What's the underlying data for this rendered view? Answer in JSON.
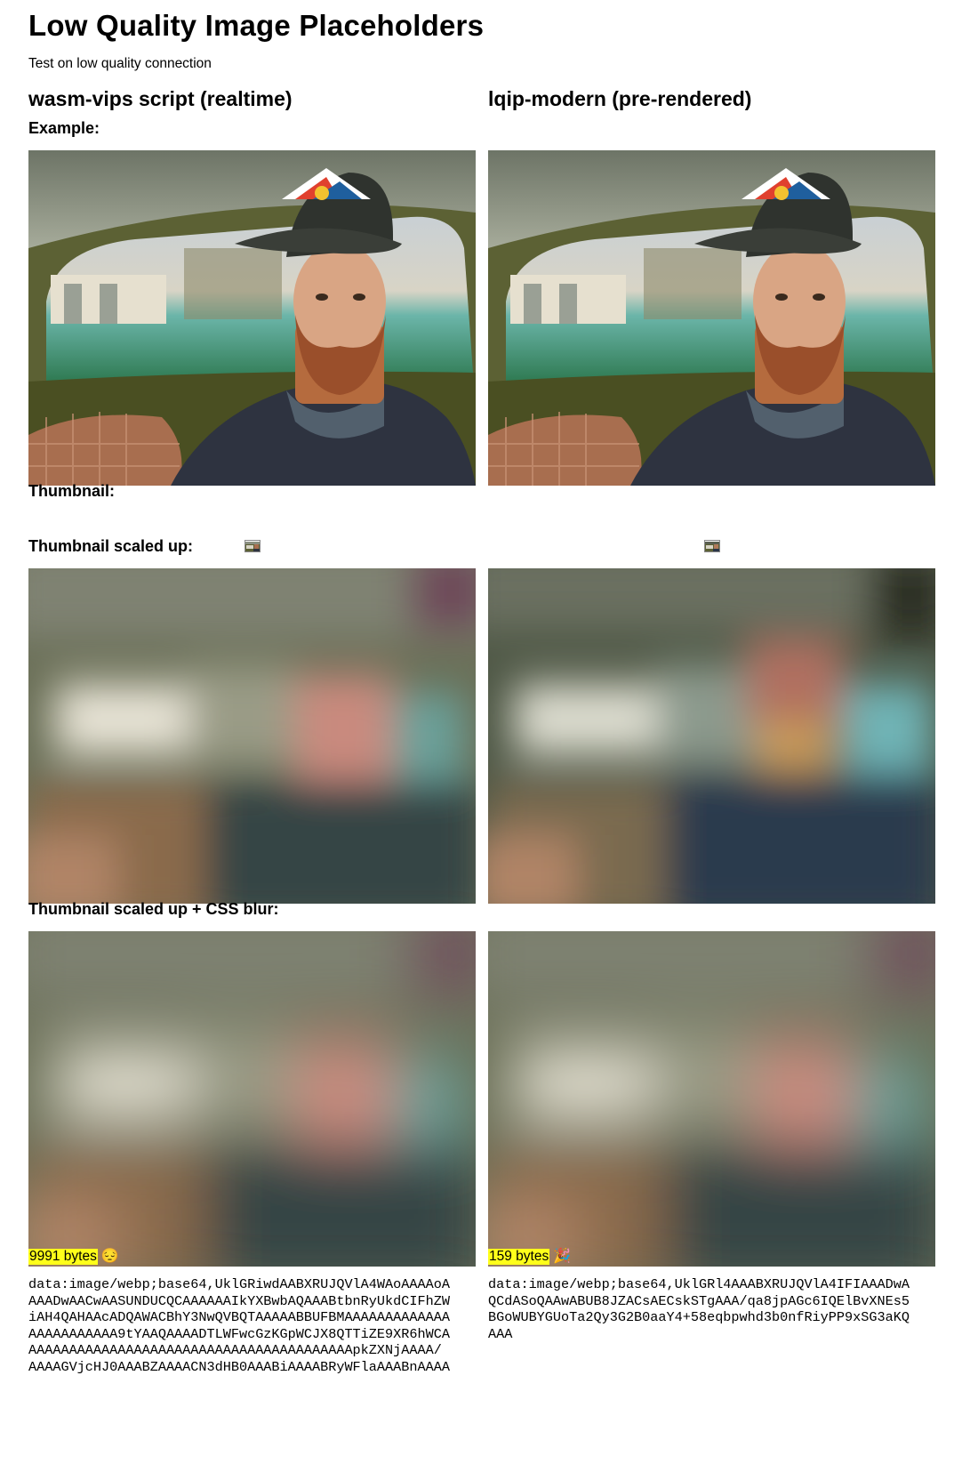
{
  "page": {
    "title": "Low Quality Image Placeholders",
    "subtitle": "Test on low quality connection"
  },
  "labels": {
    "example": "Example:",
    "thumbnail": "Thumbnail:",
    "scaled_up": "Thumbnail scaled up:",
    "scaled_up_blur": "Thumbnail scaled up + CSS blur:"
  },
  "columns": [
    {
      "heading": "wasm-vips script (realtime)",
      "bytes": "9991 bytes",
      "emoji": "😔",
      "data_uri": "data:image/webp;base64,UklGRiwdAABXRUJQVlA4WAoAAAAoA\nAAADwAACwAASUNDUCQCAAAAAAIkYXBwbAQAAABtbnRyUkdCIFhZW\niAH4QAHAAcADQAWACBhY3NwQVBQTAAAAABBUFBMAAAAAAAAAAAAA\nAAAAAAAAAAA9tYAAQAAAADTLWFwcGzKGpWCJX8QTTiZE9XR6hWCA\nAAAAAAAAAAAAAAAAAAAAAAAAAAAAAAAAAAAAAAAApkZXNjAAAA/\nAAAAGVjcHJ0AAABZAAAACN3dHB0AAABiAAAABRyWFlaAAABnAAAA"
    },
    {
      "heading": "lqip-modern (pre-rendered)",
      "bytes": "159 bytes",
      "emoji": "🎉",
      "data_uri": "data:image/webp;base64,UklGRl4AAABXRUJQVlA4IFIAAADwA\nQCdASoQAAwABUB8JZACsAECskSTgAAA/qa8jpAGc6IQElBvXNEs5\nBGoWUBYGUoTa2Qy3G2B0aaY4+58eqbpwhd3b0nfRiyPP9xSG3aKQ\nAAA"
    }
  ],
  "images": {
    "example_alt": "selfie in car",
    "thumb_alt": "thumbnail"
  }
}
